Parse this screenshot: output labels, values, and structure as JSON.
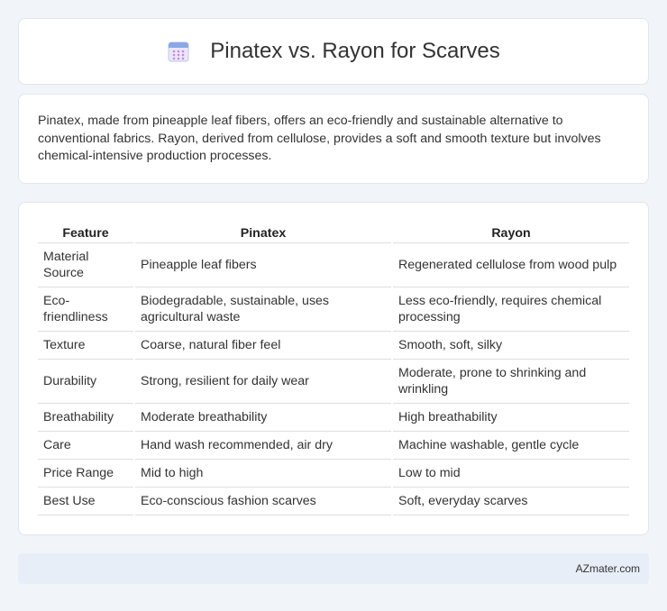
{
  "page": {
    "title": "Pinatex vs. Rayon for Scarves",
    "title_icon": "calendar-icon",
    "description": "Pinatex, made from pineapple leaf fibers, offers an eco-friendly and sustainable alternative to conventional fabrics. Rayon, derived from cellulose, provides a soft and smooth texture but involves chemical-intensive production processes."
  },
  "table": {
    "headers": [
      "Feature",
      "Pinatex",
      "Rayon"
    ],
    "rows": [
      [
        "Material Source",
        "Pineapple leaf fibers",
        "Regenerated cellulose from wood pulp"
      ],
      [
        "Eco-friendliness",
        "Biodegradable, sustainable, uses agricultural waste",
        "Less eco-friendly, requires chemical processing"
      ],
      [
        "Texture",
        "Coarse, natural fiber feel",
        "Smooth, soft, silky"
      ],
      [
        "Durability",
        "Strong, resilient for daily wear",
        "Moderate, prone to shrinking and wrinkling"
      ],
      [
        "Breathability",
        "Moderate breathability",
        "High breathability"
      ],
      [
        "Care",
        "Hand wash recommended, air dry",
        "Machine washable, gentle cycle"
      ],
      [
        "Price Range",
        "Mid to high",
        "Low to mid"
      ],
      [
        "Best Use",
        "Eco-conscious fashion scarves",
        "Soft, everyday scarves"
      ]
    ]
  },
  "footer": {
    "brand": "AZmater.com"
  },
  "colors": {
    "background": "#f1f4f9",
    "card": "#ffffff",
    "footer_bg": "#e8eef8",
    "icon_accent": "#8aa8e8"
  }
}
